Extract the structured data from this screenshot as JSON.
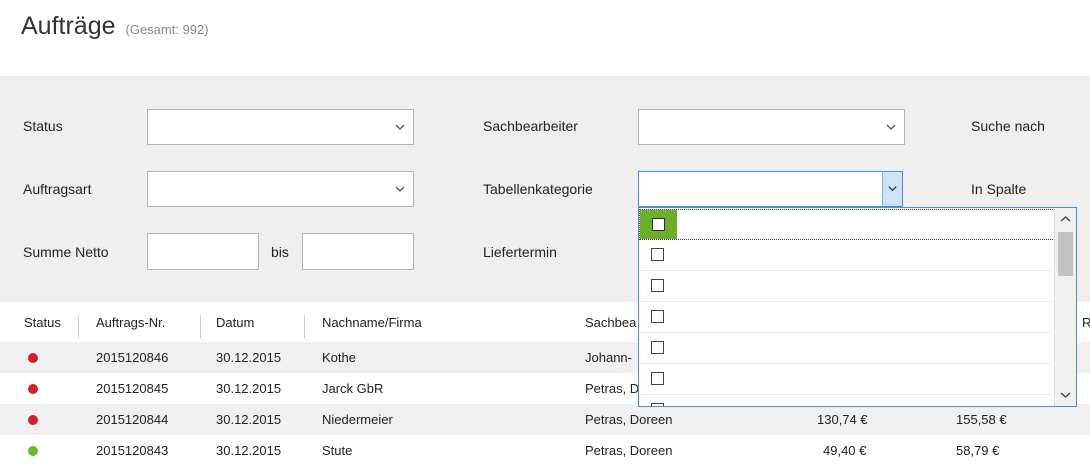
{
  "header": {
    "title": "Aufträge",
    "count": "(Gesamt: 992)"
  },
  "filters": {
    "status_label": "Status",
    "auftragsart_label": "Auftragsart",
    "summe_netto_label": "Summe Netto",
    "bis_label": "bis",
    "sachbearbeiter_label": "Sachbearbeiter",
    "tabellenkategorie_label": "Tabellenkategorie",
    "liefertermin_label": "Liefertermin",
    "suche_nach_label": "Suche nach",
    "in_spalte_label": "In Spalte"
  },
  "table": {
    "columns": [
      "Status",
      "Auftrags-Nr.",
      "Datum",
      "Nachname/Firma",
      "Sachbea",
      "R"
    ],
    "rows": [
      {
        "status_color": "#d0202a",
        "nr": "2015120846",
        "datum": "30.12.2015",
        "name": "Kothe",
        "sachbearbeiter": "Johann-",
        "netto": "",
        "brutto": ""
      },
      {
        "status_color": "#d0202a",
        "nr": "2015120845",
        "datum": "30.12.2015",
        "name": "Jarck GbR",
        "sachbearbeiter": "Petras, D",
        "netto": "",
        "brutto": ""
      },
      {
        "status_color": "#d0202a",
        "nr": "2015120844",
        "datum": "30.12.2015",
        "name": "Niedermeier",
        "sachbearbeiter": "Petras, Doreen",
        "netto": "130,74 €",
        "brutto": "155,58 €"
      },
      {
        "status_color": "#6cb83a",
        "nr": "2015120843",
        "datum": "30.12.2015",
        "name": "Stute",
        "sachbearbeiter": "Petras, Doreen",
        "netto": "49,40 €",
        "brutto": "58,79 €"
      }
    ]
  },
  "dropdown_list": {
    "item_count_visible": 7
  },
  "colors": {
    "accent": "#4a8fd6",
    "highlight": "#6cae2a",
    "status_red": "#d0202a",
    "status_green": "#6cb83a"
  }
}
